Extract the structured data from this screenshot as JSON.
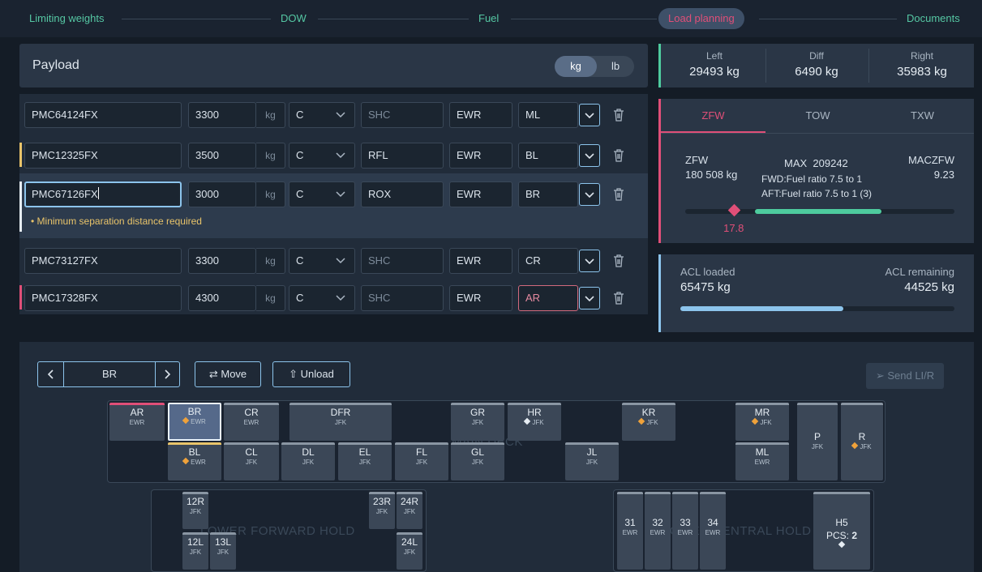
{
  "stepper": {
    "steps": [
      "Limiting weights",
      "DOW",
      "Fuel",
      "Load planning",
      "Documents"
    ],
    "active": "Load planning"
  },
  "payload": {
    "title": "Payload",
    "unit_kg": "kg",
    "unit_lb": "lb"
  },
  "rows": [
    {
      "id": "PMC64124FX",
      "weight": "3300",
      "unit": "kg",
      "cls": "C",
      "shc": "SHC",
      "shc_placeholder": true,
      "dest": "EWR",
      "pos": "ML",
      "marker": ""
    },
    {
      "id": "PMC12325FX",
      "weight": "3500",
      "unit": "kg",
      "cls": "C",
      "shc": "RFL",
      "shc_placeholder": false,
      "dest": "EWR",
      "pos": "BL",
      "marker": "#e9c46a"
    },
    {
      "id": "PMC67126FX",
      "weight": "3000",
      "unit": "kg",
      "cls": "C",
      "shc": "ROX",
      "shc_placeholder": false,
      "dest": "EWR",
      "pos": "BR",
      "marker": "#e6edf3"
    },
    {
      "id": "PMC73127FX",
      "weight": "3300",
      "unit": "kg",
      "cls": "C",
      "shc": "SHC",
      "shc_placeholder": true,
      "dest": "EWR",
      "pos": "CR",
      "marker": ""
    },
    {
      "id": "PMC17328FX",
      "weight": "4300",
      "unit": "kg",
      "cls": "C",
      "shc": "SHC",
      "shc_placeholder": true,
      "dest": "EWR",
      "pos": "AR",
      "marker": "#e04f78"
    }
  ],
  "warning": "Minimum separation distance required",
  "balance": {
    "left_label": "Left",
    "left_value": "29493 kg",
    "diff_label": "Diff",
    "diff_value": "6490 kg",
    "right_label": "Right",
    "right_value": "35983 kg"
  },
  "weights": {
    "tabs": [
      "ZFW",
      "TOW",
      "TXW"
    ],
    "zfw_label": "ZFW",
    "zfw_value": "180 508 kg",
    "max_label": "MAX  209242",
    "fwd": "FWD:Fuel ratio 7.5 to 1",
    "aft": "AFT:Fuel ratio 7.5 to 1 (3)",
    "mac_label": "MACZFW",
    "mac_value": "9.23",
    "marker_value": "17.8",
    "marker_fraction": 0.18,
    "range_start": 0.26,
    "range_end": 0.73
  },
  "acl": {
    "loaded_label": "ACL loaded",
    "loaded_value": "65475 kg",
    "remaining_label": "ACL remaining",
    "remaining_value": "44525 kg",
    "fraction": 0.595
  },
  "toolbar": {
    "position": "BR",
    "move": "Move",
    "unload": "Unload",
    "send": "Send LI/R"
  },
  "holds": {
    "main_deck_ghost": "MAIN DECK",
    "lower_fwd": "LOWER FORWARD HOLD",
    "lower_aft": "LOWER CENTRAL HOLD",
    "main": [
      {
        "n": "AR",
        "d": "EWR"
      },
      {
        "n": "BR",
        "d": "EWR"
      },
      {
        "n": "CR",
        "d": "EWR"
      },
      {
        "n": "DFR",
        "d": "JFK"
      },
      {
        "n": "GR",
        "d": "JFK"
      },
      {
        "n": "HR",
        "d": "JFK"
      },
      {
        "n": "KR",
        "d": "JFK"
      },
      {
        "n": "MR",
        "d": "JFK"
      },
      {
        "n": "P",
        "d": "JFK"
      },
      {
        "n": "R",
        "d": "JFK"
      },
      {
        "n": "BL",
        "d": "EWR"
      },
      {
        "n": "CL",
        "d": "JFK"
      },
      {
        "n": "DL",
        "d": "JFK"
      },
      {
        "n": "EL",
        "d": "JFK"
      },
      {
        "n": "FL",
        "d": "JFK"
      },
      {
        "n": "GL",
        "d": "JFK"
      },
      {
        "n": "JL",
        "d": "JFK"
      },
      {
        "n": "ML",
        "d": "EWR"
      }
    ],
    "fwd": [
      {
        "n": "12R",
        "d": "JFK"
      },
      {
        "n": "23R",
        "d": "JFK"
      },
      {
        "n": "24R",
        "d": "JFK"
      },
      {
        "n": "12L",
        "d": "JFK"
      },
      {
        "n": "13L",
        "d": "JFK"
      },
      {
        "n": "24L",
        "d": "JFK"
      }
    ],
    "aft": [
      {
        "n": "31",
        "d": "EWR"
      },
      {
        "n": "32",
        "d": "EWR"
      },
      {
        "n": "33",
        "d": "EWR"
      },
      {
        "n": "34",
        "d": "EWR"
      }
    ],
    "bulk": {
      "n": "H5",
      "pcs_label": "PCS:",
      "pcs": "2"
    }
  },
  "colors": {
    "accent_green": "#4ecb9e",
    "accent_pink": "#e04f78",
    "accent_blue": "#8cc4ec",
    "warn_yellow": "#e9c46a",
    "diamond_orange": "#f0a23a"
  }
}
